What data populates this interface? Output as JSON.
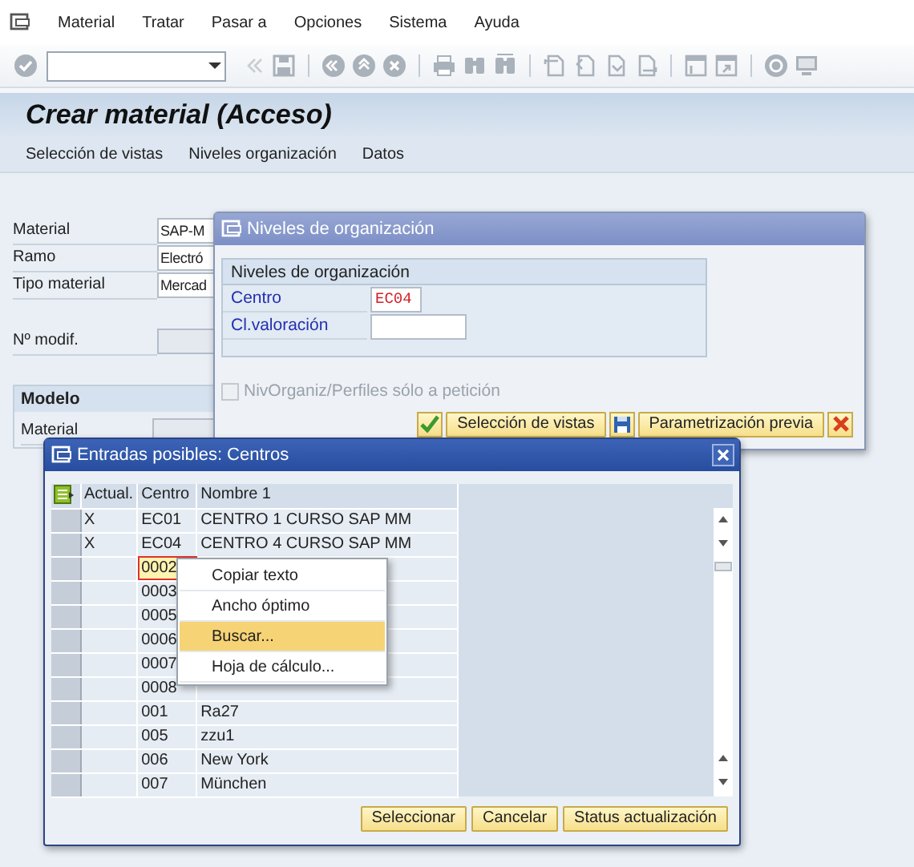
{
  "menu_bar": {
    "items": [
      "Material",
      "Tratar",
      "Pasar a",
      "Opciones",
      "Sistema",
      "Ayuda"
    ]
  },
  "screen": {
    "title": "Crear material (Acceso)",
    "app_toolbar": [
      "Selección de vistas",
      "Niveles organización",
      "Datos"
    ],
    "fields": [
      {
        "label": "Material",
        "value": "SAP-M"
      },
      {
        "label": "Ramo",
        "value": "Electró"
      },
      {
        "label": "Tipo material",
        "value": "Mercad"
      },
      {
        "label": "Nº modif."
      }
    ],
    "modelo": {
      "title": "Modelo",
      "fields": [
        {
          "label": "Material"
        }
      ]
    }
  },
  "org_dialog": {
    "title": "Niveles de organización",
    "group_title": "Niveles de organización",
    "fields": [
      {
        "label": "Centro",
        "value": "EC04"
      },
      {
        "label": "Cl.valoración"
      }
    ],
    "checkbox": {
      "label": "NivOrganiz/Perfiles sólo a petición",
      "checked": false,
      "disabled": true
    },
    "buttons": [
      "Selección de vistas",
      "Parametrización previa"
    ]
  },
  "values_dialog": {
    "title": "Entradas posibles: Centros",
    "columns": [
      "Actual.",
      "Centro",
      "Nombre 1"
    ],
    "rows": [
      {
        "actual": "X",
        "centro": "EC01",
        "nombre": "CENTRO 1 CURSO SAP MM",
        "selected": false
      },
      {
        "actual": "X",
        "centro": "EC04",
        "nombre": "CENTRO 4 CURSO SAP MM",
        "selected": false
      },
      {
        "centro": "0002",
        "selected": true
      },
      {
        "centro": "0003",
        "selected": false
      },
      {
        "centro": "0005",
        "selected": false
      },
      {
        "centro": "0006",
        "selected": false
      },
      {
        "centro": "0007",
        "selected": false
      },
      {
        "centro": "0008",
        "selected": false
      },
      {
        "centro": "001",
        "nombre": "Ra27",
        "selected": false
      },
      {
        "centro": "005",
        "nombre": "zzu1",
        "selected": false
      },
      {
        "centro": "006",
        "nombre": "New York",
        "selected": false
      },
      {
        "centro": "007",
        "nombre": "München",
        "selected": false
      }
    ],
    "buttons": [
      "Seleccionar",
      "Cancelar",
      "Status actualización"
    ]
  },
  "context_menu": {
    "items": [
      {
        "label": "Copiar texto",
        "selected": false
      },
      {
        "label": "Ancho óptimo",
        "selected": false
      },
      {
        "label": "Buscar...",
        "selected": true
      },
      {
        "label": "Hoja de cálculo...",
        "selected": false
      }
    ]
  }
}
